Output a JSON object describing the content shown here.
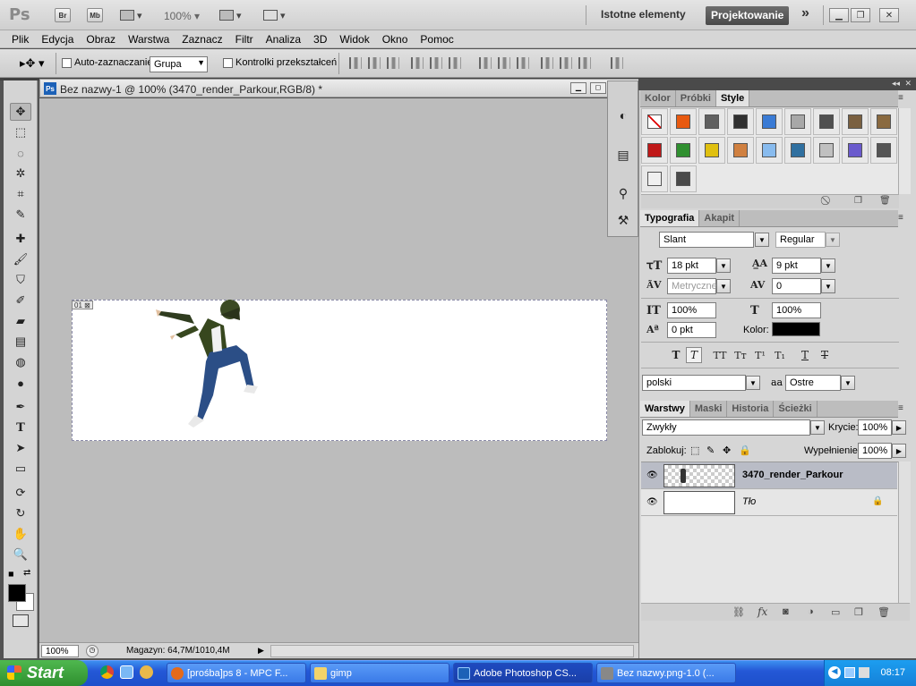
{
  "app": {
    "logo": "Ps",
    "bridge_btn": "Br",
    "minibridge_btn": "Mb",
    "zoom_display": "100%",
    "ws_essentials": "Istotne elementy",
    "ws_design": "Projektowanie",
    "ws_more": "»"
  },
  "menu": [
    "Plik",
    "Edycja",
    "Obraz",
    "Warstwa",
    "Zaznacz",
    "Filtr",
    "Analiza",
    "3D",
    "Widok",
    "Okno",
    "Pomoc"
  ],
  "options": {
    "auto_select_label": "Auto-zaznaczanie:",
    "auto_select_value": "Grupa",
    "transform_label": "Kontrolki przekształceń"
  },
  "document": {
    "title": "Bez nazwy-1 @ 100% (3470_render_Parkour,RGB/8) *",
    "slice_label": "01"
  },
  "status": {
    "zoom": "100%",
    "info": "Magazyn: 64,7M/1010,4M"
  },
  "panels": {
    "color_tabs": [
      "Kolor",
      "Próbki",
      "Style"
    ],
    "type_tabs": [
      "Typografia",
      "Akapit"
    ],
    "layer_tabs": [
      "Warstwy",
      "Maski",
      "Historia",
      "Ścieżki"
    ],
    "font_family": "Slant",
    "font_style": "Regular",
    "font_size": "18 pkt",
    "leading": "9 pkt",
    "kerning": "Metryczne",
    "tracking": "0",
    "vscale": "100%",
    "hscale": "100%",
    "baseline": "0 pkt",
    "color_label": "Kolor:",
    "language": "polski",
    "aa_label": "aa",
    "antialias": "Ostre",
    "blend_mode": "Zwykły",
    "opacity_label": "Krycie:",
    "opacity": "100%",
    "lock_label": "Zablokuj:",
    "fill_label": "Wypełnienie:",
    "fill": "100%",
    "layers": [
      {
        "name": "3470_render_Parkour"
      },
      {
        "name": "Tło"
      }
    ],
    "style_colors": [
      "#ffffff",
      "#e85a10",
      "#606060",
      "#303030",
      "#3a7bd5",
      "#a8a8a8",
      "#505050",
      "#7a6040",
      "#8a6a40",
      "#c01818",
      "#309030",
      "#e0c010",
      "#d08040",
      "#88bbee",
      "#3070a0",
      "#c0c0c0",
      "#6a5acd",
      "#555555",
      "#f0f0f0",
      "#4a4a4a"
    ]
  },
  "taskbar": {
    "start": "Start",
    "apps": [
      "[prośba]ps 8 - MPC F...",
      "gimp",
      "Adobe Photoshop CS...",
      "Bez nazwy.png-1.0 (..."
    ],
    "clock": "08:17"
  }
}
